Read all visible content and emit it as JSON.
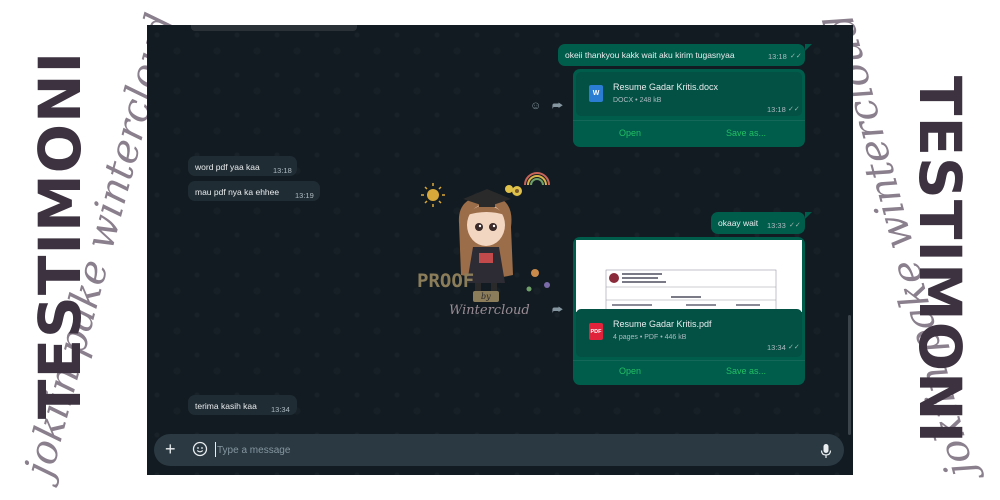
{
  "decor": {
    "side_title": "TESTIMONI",
    "side_script": "jokiin pake wintercloud"
  },
  "watermark": {
    "title": "PROOF",
    "by": "by",
    "name": "Wintercloud"
  },
  "chat": {
    "messages": [
      {
        "text": "okeii thankyou kakk wait aku kirim tugasnyaa",
        "time": "13:18"
      },
      {
        "name": "Resume Gadar Kritis.docx",
        "meta": "DOCX • 248 kB",
        "time": "13:18",
        "icon_label": "W",
        "open": "Open",
        "save": "Save as..."
      },
      {
        "text": "word pdf yaa kaa",
        "time": "13:18"
      },
      {
        "text": "mau pdf nya ka ehhee",
        "time": "13:19"
      },
      {
        "text": "okaay wait",
        "time": "13:33"
      },
      {
        "name": "Resume Gadar Kritis.pdf",
        "meta": "4 pages • PDF • 446 kB",
        "time": "13:34",
        "icon_label": "PDF",
        "open": "Open",
        "save": "Save as..."
      },
      {
        "text": "terima kasih kaa",
        "time": "13:34"
      }
    ]
  },
  "composer": {
    "placeholder": "Type a message",
    "icons": [
      "plus-icon",
      "sticker-icon",
      "microphone-icon"
    ]
  },
  "colors": {
    "chat_background": "#111b21",
    "outgoing_bubble": "#005c4b",
    "incoming_bubble": "#202c33",
    "accent_green": "#21c063",
    "word_icon": "#2b7cd3",
    "pdf_icon": "#e0223b"
  }
}
